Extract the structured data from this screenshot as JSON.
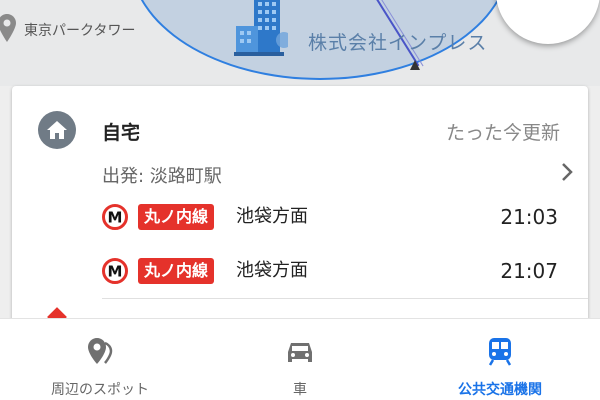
{
  "map": {
    "tower_label": "東京パークタワー",
    "company_label": "株式会社インプレス"
  },
  "card": {
    "destination": "自宅",
    "updated": "たった今更新",
    "station": "出発: 淡路町駅",
    "departures": [
      {
        "line": "丸ノ内線",
        "direction": "池袋方面",
        "time": "21:03"
      },
      {
        "line": "丸ノ内線",
        "direction": "池袋方面",
        "time": "21:07"
      }
    ]
  },
  "nav": {
    "items": [
      {
        "label": "周辺のスポット",
        "icon": "place-icon",
        "active": false
      },
      {
        "label": "車",
        "icon": "car-icon",
        "active": false
      },
      {
        "label": "公共交通機関",
        "icon": "train-icon",
        "active": true
      }
    ]
  },
  "colors": {
    "accent": "#1a73e8",
    "line_badge": "#e5322b",
    "home_badge": "#707b86"
  }
}
